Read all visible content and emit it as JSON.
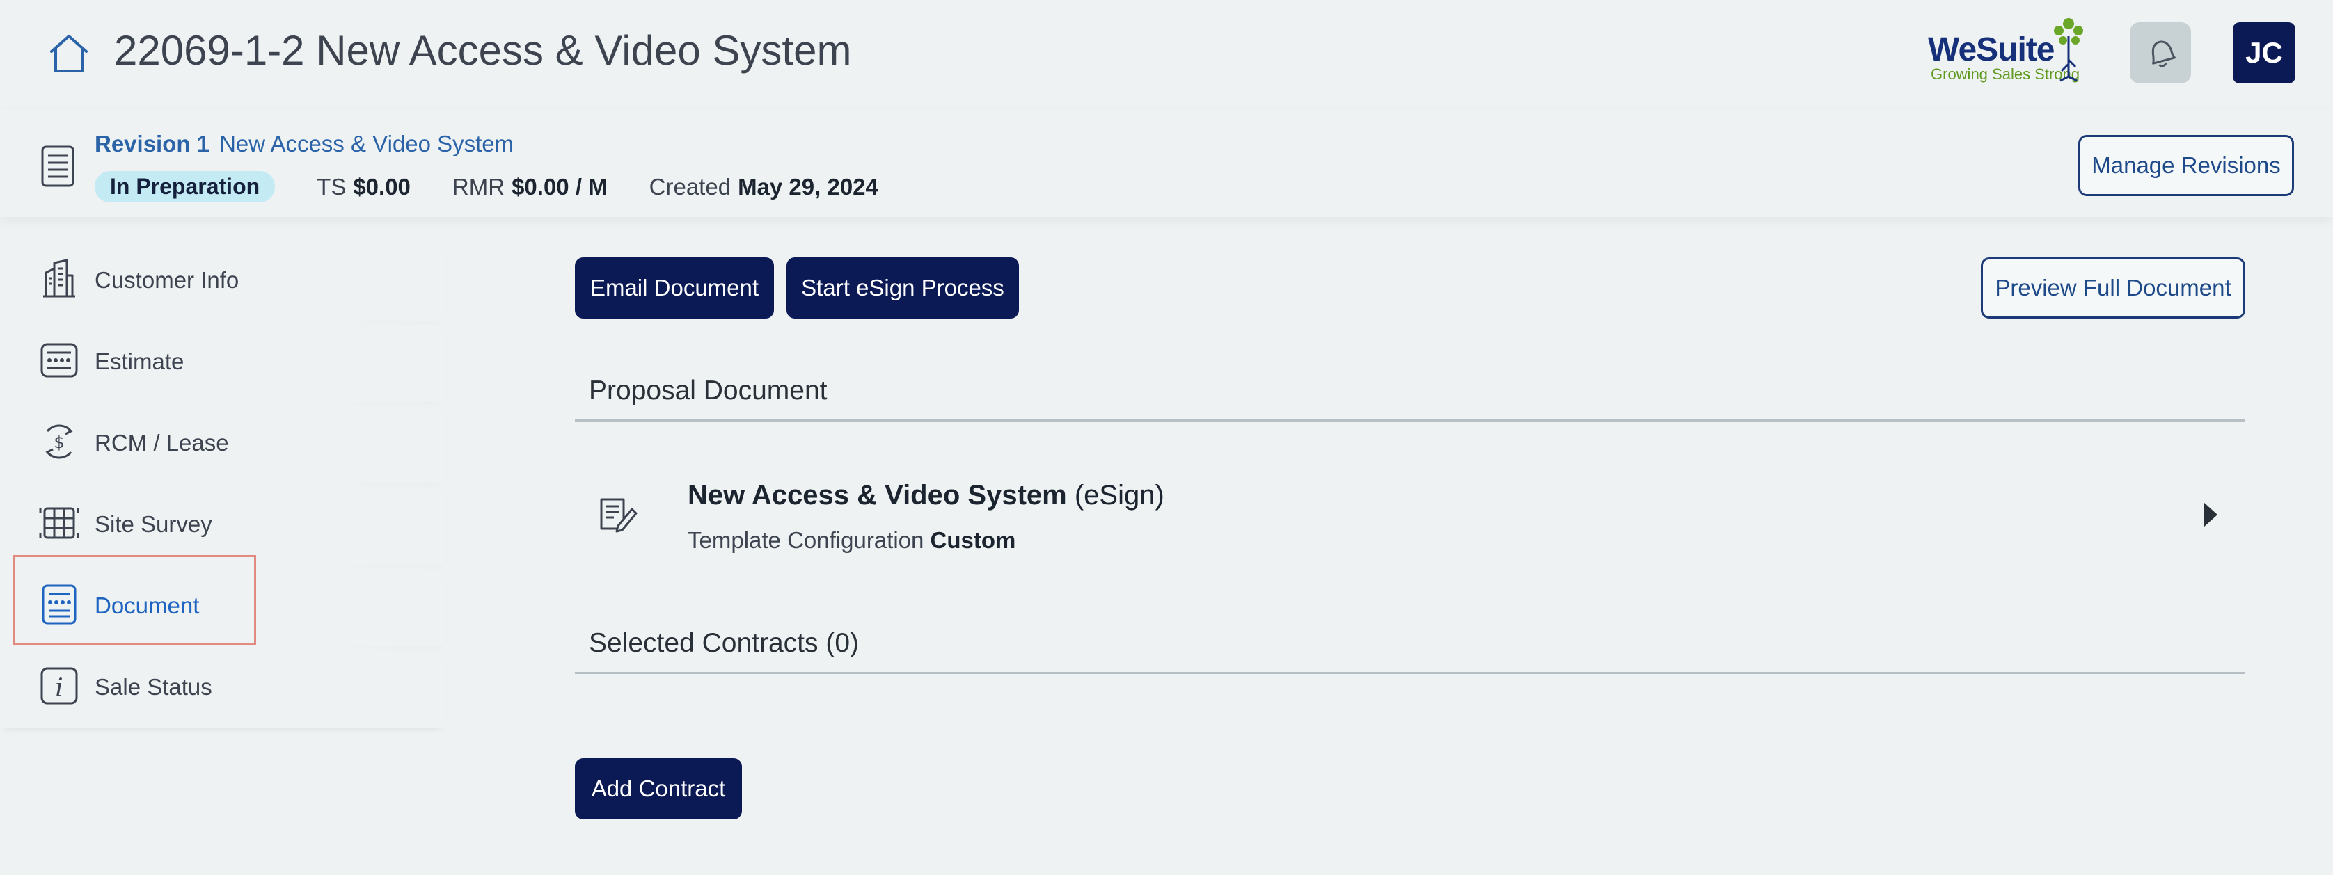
{
  "header": {
    "title": "22069-1-2 New Access & Video System",
    "logo": {
      "word": "WeSuite",
      "tagline": "Growing Sales Strong"
    },
    "avatar_initials": "JC"
  },
  "revision": {
    "label": "Revision 1",
    "name": "New Access & Video System",
    "status": "In Preparation",
    "ts_label": "TS",
    "ts_value": "$0.00",
    "rmr_label": "RMR",
    "rmr_value": "$0.00 / M",
    "created_label": "Created",
    "created_value": "May 29, 2024",
    "manage_label": "Manage Revisions"
  },
  "sidebar": {
    "items": [
      {
        "label": "Customer Info",
        "icon": "building-icon"
      },
      {
        "label": "Estimate",
        "icon": "estimate-icon"
      },
      {
        "label": "RCM / Lease",
        "icon": "dollar-cycle-icon"
      },
      {
        "label": "Site Survey",
        "icon": "grid-icon"
      },
      {
        "label": "Document",
        "icon": "document-icon",
        "active": true
      },
      {
        "label": "Sale Status",
        "icon": "info-icon"
      }
    ]
  },
  "main": {
    "email_label": "Email Document",
    "esign_label": "Start eSign Process",
    "preview_label": "Preview Full Document",
    "proposal_heading": "Proposal Document",
    "document": {
      "title": "New Access & Video System",
      "suffix": "(eSign)",
      "config_label": "Template Configuration",
      "config_value": "Custom"
    },
    "contracts_heading": "Selected Contracts (0)",
    "add_contract_label": "Add Contract"
  },
  "colors": {
    "background": "#eef2f3",
    "primary_dark": "#0b1a55",
    "accent_blue": "#2b63a8",
    "badge_bg": "#c4ebf3",
    "active_link": "#1f64c0"
  }
}
